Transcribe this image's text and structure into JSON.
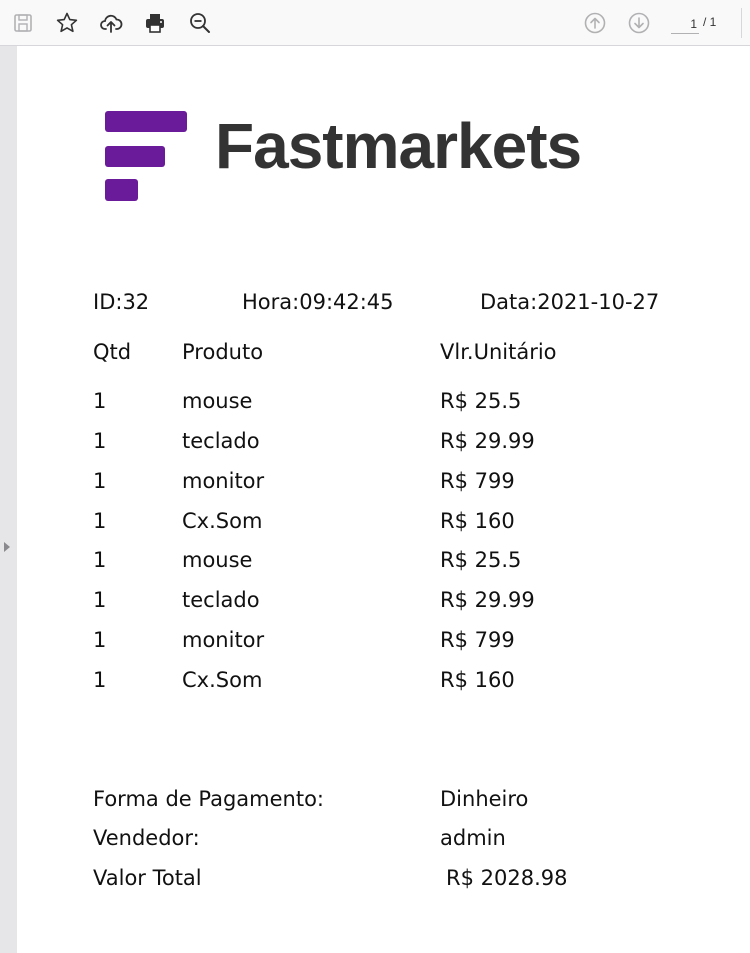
{
  "toolbar": {
    "current_page": "1",
    "total_pages": "/ 1"
  },
  "brand": {
    "name": "Fastmarkets",
    "color": "#6a1b9a"
  },
  "receipt": {
    "id": "ID:32",
    "hora": "Hora:09:42:45",
    "data": "Data:2021-10-27",
    "headers": {
      "qtd": "Qtd",
      "produto": "Produto",
      "valor": "Vlr.Unitário"
    },
    "items": [
      {
        "qtd": "1",
        "produto": "mouse",
        "valor": "R$ 25.5"
      },
      {
        "qtd": "1",
        "produto": "teclado",
        "valor": "R$ 29.99"
      },
      {
        "qtd": "1",
        "produto": "monitor",
        "valor": "R$ 799"
      },
      {
        "qtd": "1",
        "produto": "Cx.Som",
        "valor": "R$ 160"
      },
      {
        "qtd": "1",
        "produto": "mouse",
        "valor": "R$ 25.5"
      },
      {
        "qtd": "1",
        "produto": "teclado",
        "valor": "R$ 29.99"
      },
      {
        "qtd": "1",
        "produto": "monitor",
        "valor": "R$ 799"
      },
      {
        "qtd": "1",
        "produto": "Cx.Som",
        "valor": "R$ 160"
      }
    ],
    "footer": {
      "pagamento_label": "Forma de Pagamento:",
      "pagamento_value": "Dinheiro",
      "vendedor_label": "Vendedor:",
      "vendedor_value": "admin",
      "total_label": "Valor Total",
      "total_value": "R$ 2028.98"
    }
  }
}
